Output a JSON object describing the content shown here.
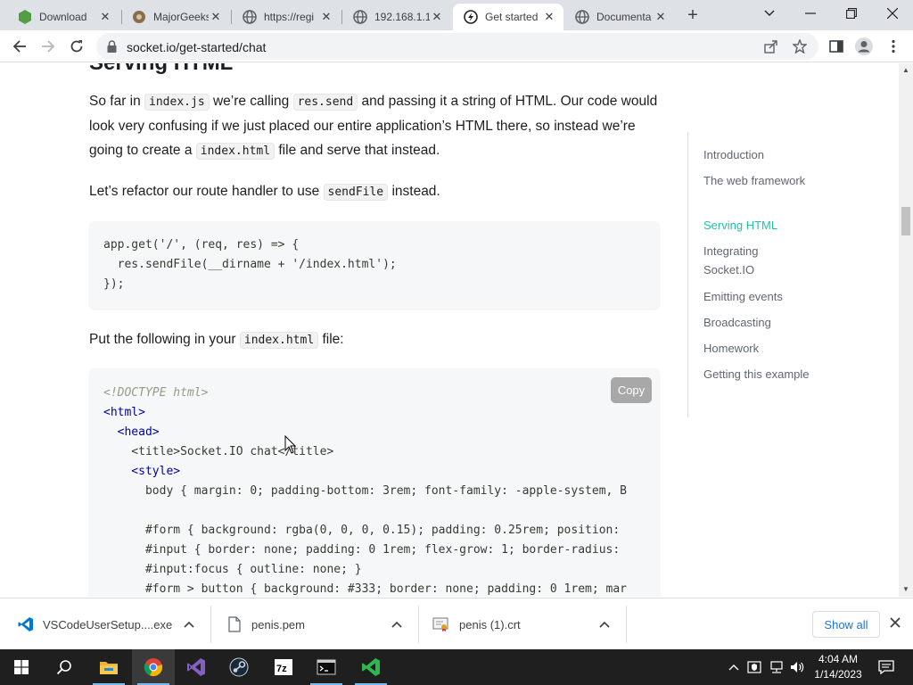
{
  "tabs": [
    {
      "label": "Download",
      "icon": "node-icon",
      "active": false
    },
    {
      "label": "MajorGeeks",
      "icon": "majorgeeks-icon",
      "active": false
    },
    {
      "label": "https://regi",
      "icon": "globe-icon",
      "active": false
    },
    {
      "label": "192.168.1.1",
      "icon": "globe-icon",
      "active": false
    },
    {
      "label": "Get started",
      "icon": "socketio-icon",
      "active": true
    },
    {
      "label": "Documenta",
      "icon": "globe-icon",
      "active": false
    }
  ],
  "address_bar": {
    "url": "socket.io/get-started/chat"
  },
  "article": {
    "heading": "Serving HTML",
    "p1": {
      "t1": "So far in ",
      "c1": "index.js",
      "t2": " we’re calling ",
      "c2": "res.send",
      "t3": " and passing it a string of HTML. Our code would look very confusing if we just placed our entire application’s HTML there, so instead we’re going to create a ",
      "c3": "index.html",
      "t4": " file and serve that instead."
    },
    "p2": {
      "t1": "Let’s refactor our route handler to use ",
      "c1": "sendFile",
      "t2": " instead."
    },
    "code1": [
      "app.get('/', (req, res) => {",
      "  res.sendFile(__dirname + '/index.html');",
      "});"
    ],
    "p3": {
      "t1": "Put the following in your ",
      "c1": "index.html",
      "t2": " file:"
    },
    "code2": [
      "<!DOCTYPE html>",
      "<html>",
      "  <head>",
      "    <title>Socket.IO chat</title>",
      "    <style>",
      "      body { margin: 0; padding-bottom: 3rem; font-family: -apple-system, B",
      "",
      "      #form { background: rgba(0, 0, 0, 0.15); padding: 0.25rem; position:",
      "      #input { border: none; padding: 0 1rem; flex-grow: 1; border-radius:",
      "      #input:focus { outline: none; }",
      "      #form > button { background: #333; border: none; padding: 0 1rem; mar"
    ],
    "copy_label": "Copy"
  },
  "toc": [
    {
      "label": "Introduction",
      "active": false
    },
    {
      "label": "The web framework",
      "active": false
    },
    {
      "label": "Serving HTML",
      "active": true
    },
    {
      "label": "Integrating Socket.IO",
      "active": false
    },
    {
      "label": "Emitting events",
      "active": false
    },
    {
      "label": "Broadcasting",
      "active": false
    },
    {
      "label": "Homework",
      "active": false
    },
    {
      "label": "Getting this example",
      "active": false
    }
  ],
  "downloads": [
    {
      "name": "VSCodeUserSetup....exe",
      "icon": "vscode-icon"
    },
    {
      "name": "penis.pem",
      "icon": "file-icon"
    },
    {
      "name": "penis (1).crt",
      "icon": "certificate-icon"
    }
  ],
  "download_bar": {
    "show_all": "Show all"
  },
  "taskbar": {
    "time": "4:04 AM",
    "date": "1/14/2023"
  },
  "colors": {
    "accent": "#25c2a0",
    "tabstrip": "#dee1e6",
    "taskbar": "#1f1f1f",
    "link": "#1a73e8"
  }
}
